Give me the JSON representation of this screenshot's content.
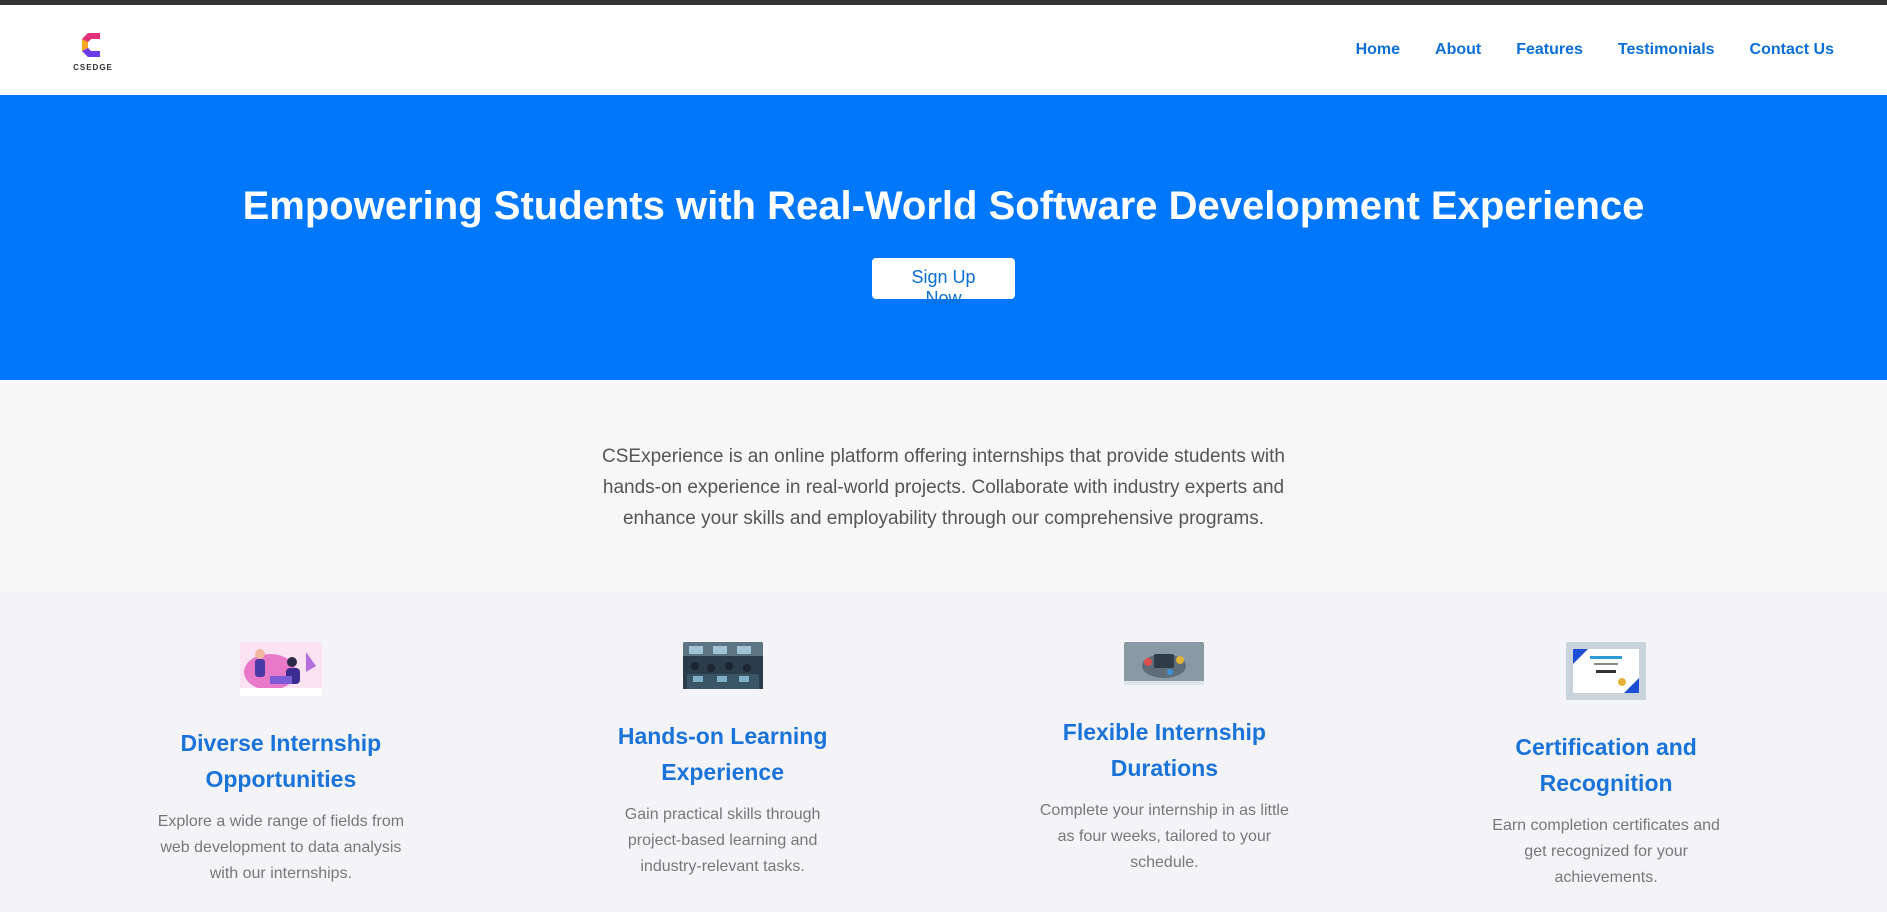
{
  "brand": {
    "name": "CSEDGE"
  },
  "nav": {
    "items": [
      {
        "label": "Home"
      },
      {
        "label": "About"
      },
      {
        "label": "Features"
      },
      {
        "label": "Testimonials"
      },
      {
        "label": "Contact Us"
      }
    ]
  },
  "hero": {
    "title": "Empowering Students with Real-World Software Development Experience",
    "cta": "Sign Up Now",
    "background": "#0178fc"
  },
  "intro": {
    "text": "CSExperience is an online platform offering internships that provide students with hands-on experience in real-world projects. Collaborate with industry experts and enhance your skills and employability through our comprehensive programs."
  },
  "features": [
    {
      "title": "Diverse Internship Opportunities",
      "text": "Explore a wide range of fields from web development to data analysis with our internships.",
      "icon": "internship-illustration"
    },
    {
      "title": "Hands-on Learning Experience",
      "text": "Gain practical skills through project-based learning and industry-relevant tasks.",
      "icon": "classroom-photo"
    },
    {
      "title": "Flexible Internship Durations",
      "text": "Complete your internship in as little as four weeks, tailored to your schedule.",
      "icon": "schedule-illustration"
    },
    {
      "title": "Certification and Recognition",
      "text": "Earn completion certificates and get recognized for your achievements.",
      "icon": "certificate-image"
    }
  ],
  "colors": {
    "accent": "#0a6fd6",
    "hero": "#0178fc",
    "feature_title": "#1a73d9"
  }
}
